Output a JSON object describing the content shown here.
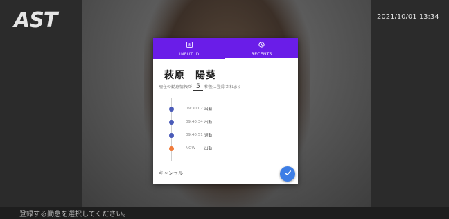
{
  "header": {
    "logo_text": "AST",
    "datetime": "2021/10/01 13:34"
  },
  "dialog": {
    "tabs": [
      {
        "label": "INPUT ID",
        "icon": "id-card-icon"
      },
      {
        "label": "RECENTS",
        "icon": "history-icon"
      }
    ],
    "active_tab": "RECENTS",
    "employee_name": "萩原　陽葵",
    "countdown_prefix": "現在の勤怠情報が",
    "countdown_value": "5",
    "countdown_suffix": "秒後に登録されます",
    "timeline": [
      {
        "time": "09:30:02",
        "type": "出勤",
        "color": "#4a5bb8"
      },
      {
        "time": "09:40:34",
        "type": "出勤",
        "color": "#4a5bb8"
      },
      {
        "time": "09:40:51",
        "type": "退勤",
        "color": "#4a5bb8"
      },
      {
        "time": "NOW",
        "type": "出勤",
        "color": "#f07a3a"
      }
    ],
    "cancel_label": "キャンセル",
    "confirm_icon": "check-icon"
  },
  "footer": {
    "message": "登録する勤怠を選択してください。"
  },
  "colors": {
    "tab_bar": "#6a1de8",
    "fab": "#3d7ee6",
    "dot_past": "#4a5bb8",
    "dot_now": "#f07a3a"
  }
}
